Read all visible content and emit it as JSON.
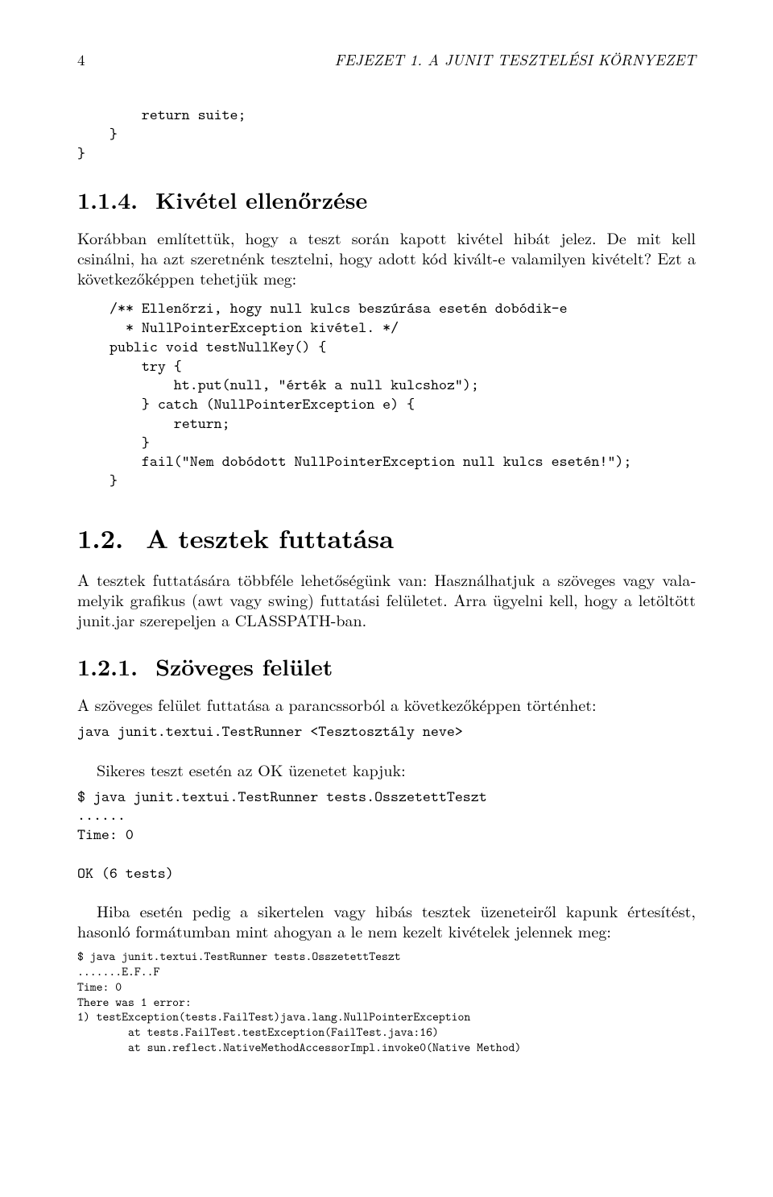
{
  "header": {
    "page_number": "4",
    "running_head": "FEJEZET 1. A JUNIT TESZTELÉSI KÖRNYEZET"
  },
  "code_intro": "        return suite;\n    }\n}",
  "sec_114": {
    "num": "1.1.4.",
    "title": "Kivétel ellenőrzése",
    "para": "Korábban említettük, hogy a teszt során kapott kivétel hibát jelez. De mit kell csinálni, ha azt szeretnénk tesztelni, hogy adott kód kivált-e valamilyen kivételt? Ezt a követke­zőképpen tehetjük meg:",
    "code": "/** Ellenőrzi, hogy null kulcs beszúrása esetén dobódik-e\n  * NullPointerException kivétel. */\npublic void testNullKey() {\n    try {\n        ht.put(null, \"érték a null kulcshoz\");\n    } catch (NullPointerException e) {\n        return;\n    }\n    fail(\"Nem dobódott NullPointerException null kulcs esetén!\");\n}"
  },
  "sec_12": {
    "num": "1.2.",
    "title": "A tesztek futtatása",
    "para": "A tesztek futtatására többféle lehetőségünk van: Használhatjuk a szöveges vagy vala­melyik grafikus (awt vagy swing) futtatási felületet. Arra ügyelni kell, hogy a letöltött junit.jar szerepeljen a CLASSPATH-ban."
  },
  "sec_121": {
    "num": "1.2.1.",
    "title": "Szöveges felület",
    "para1": "A szöveges felület futtatása a parancssorból a következőképpen történhet:",
    "code1": "java junit.textui.TestRunner <Tesztosztály neve>",
    "para2": "Sikeres teszt esetén az OK üzenetet kapjuk:",
    "code2": "$ java junit.textui.TestRunner tests.OsszetettTeszt\n......\nTime: 0\n\nOK (6 tests)",
    "para3": "Hiba esetén pedig a sikertelen vagy hibás tesztek üzeneteiről kapunk értesítést, hasonló formátumban mint ahogyan a le nem kezelt kivételek jelennek meg:",
    "code3": "$ java junit.textui.TestRunner tests.OsszetettTeszt\n.......E.F..F\nTime: 0\nThere was 1 error:\n1) testException(tests.FailTest)java.lang.NullPointerException\n        at tests.FailTest.testException(FailTest.java:16)\n        at sun.reflect.NativeMethodAccessorImpl.invoke0(Native Method)"
  }
}
